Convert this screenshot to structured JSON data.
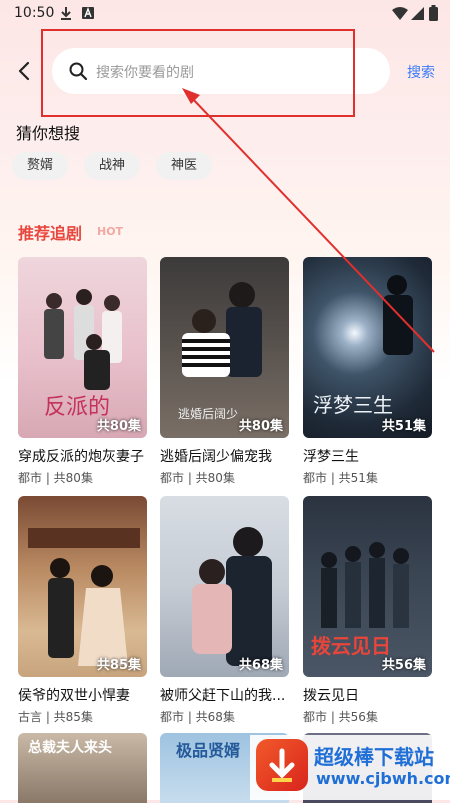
{
  "status_bar": {
    "time": "10:50"
  },
  "search": {
    "placeholder": "搜索你要看的剧",
    "button_label": "搜索"
  },
  "guess": {
    "title": "猜你想搜",
    "chips": [
      "赘婿",
      "战神",
      "神医"
    ]
  },
  "recommend": {
    "title": "推荐追剧",
    "tag": "HOT",
    "dramas": [
      {
        "title": "穿成反派的炮灰妻子",
        "genre": "都市",
        "episodes": "共80集",
        "sub": "都市 | 共80集",
        "poster_art_text": "反派的"
      },
      {
        "title": "逃婚后阔少偏宠我",
        "genre": "都市",
        "episodes": "共80集",
        "sub": "都市 | 共80集",
        "poster_art_text": "逃婚后阔少"
      },
      {
        "title": "浮梦三生",
        "genre": "都市",
        "episodes": "共51集",
        "sub": "都市 | 共51集",
        "poster_art_text": "浮梦三生"
      },
      {
        "title": "侯爷的双世小悍妻",
        "genre": "古言",
        "episodes": "共85集",
        "sub": "古言 | 共85集",
        "poster_art_text": ""
      },
      {
        "title": "被师父赶下山的我...",
        "genre": "都市",
        "episodes": "共68集",
        "sub": "都市 | 共68集",
        "poster_art_text": ""
      },
      {
        "title": "拨云见日",
        "genre": "都市",
        "episodes": "共56集",
        "sub": "都市 | 共56集",
        "poster_art_text": "拨云见日"
      }
    ],
    "partial_art": [
      "总裁夫人来头",
      "极品贤婿"
    ]
  },
  "watermark": {
    "name": "超级棒下载站",
    "url": "www.cjbwh.com"
  }
}
